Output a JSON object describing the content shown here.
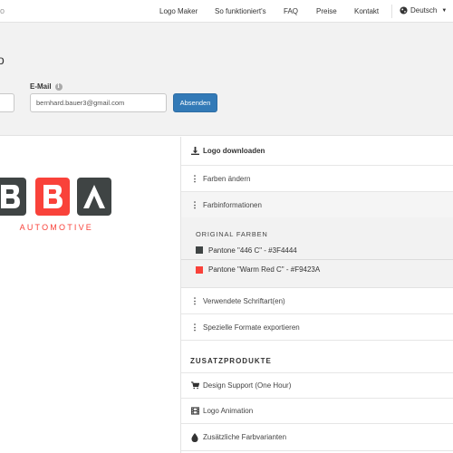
{
  "nav": {
    "brand": "o",
    "items": [
      "Logo Maker",
      "So funktioniert's",
      "FAQ",
      "Preise",
      "Kontakt"
    ],
    "language": "Deutsch"
  },
  "form": {
    "title": "o",
    "email_label": "E-Mail",
    "email_value": "bernhard.bauer3@gmail.com",
    "submit_label": "Absenden"
  },
  "logo": {
    "letters": [
      "B",
      "B",
      "A"
    ],
    "tagline": "AUTOMOTIVE"
  },
  "panel": {
    "download_label": "Logo downloaden",
    "change_colors_label": "Farben ändern",
    "color_info_label": "Farbinformationen",
    "original_colors_title": "ORIGINAL FARBEN",
    "colors": [
      {
        "label": "Pantone \"446 C\" - #3F4444",
        "hex": "#3F4444"
      },
      {
        "label": "Pantone \"Warm Red C\" - #F9423A",
        "hex": "#F9423A"
      }
    ],
    "fonts_label": "Verwendete Schriftart(en)",
    "export_label": "Spezielle Formate exportieren",
    "addons_title": "ZUSATZPRODUKTE",
    "addons": [
      "Design Support (One Hour)",
      "Logo Animation",
      "Zusätzliche Farbvarianten"
    ]
  },
  "theme": {
    "accent": "#337ab7",
    "tile_color": "#3F4444",
    "brand_red": "#F9423A"
  }
}
